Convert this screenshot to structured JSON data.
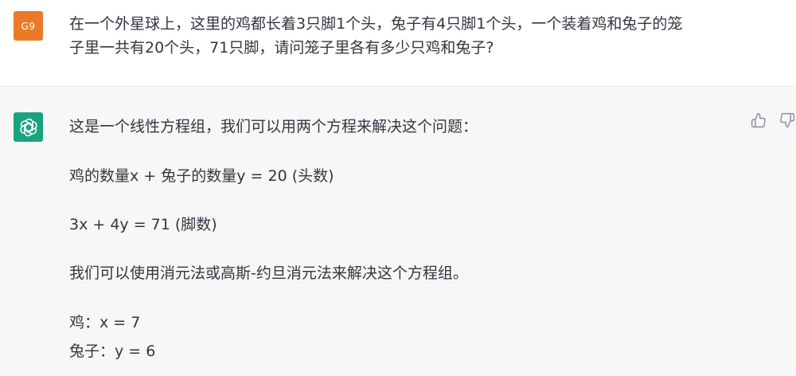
{
  "user_message": {
    "avatar_label": "G9",
    "lines": [
      "在一个外星球上，这里的鸡都长着3只脚1个头，兔子有4只脚1个头，一个装着鸡和兔子的笼",
      "子里一共有20个头，71只脚，请问笼子里各有多少只鸡和兔子?"
    ]
  },
  "assistant_message": {
    "paragraphs": [
      "这是一个线性方程组，我们可以用两个方程来解决这个问题：",
      "鸡的数量x + 兔子的数量y = 20 (头数)",
      "3x + 4y = 71 (脚数)",
      "我们可以使用消元法或高斯-约旦消元法来解决这个方程组。",
      "鸡：x = 7",
      "兔子：y = 6"
    ]
  },
  "icons": {
    "bot_avatar": "openai-logo-icon",
    "thumbs_up": "thumbs-up-icon",
    "thumbs_down": "thumbs-down-icon"
  },
  "colors": {
    "user_avatar_bg": "#eb7a28",
    "bot_avatar_bg": "#19a37f",
    "assistant_bg": "#f7f7f8",
    "text": "#343541"
  }
}
